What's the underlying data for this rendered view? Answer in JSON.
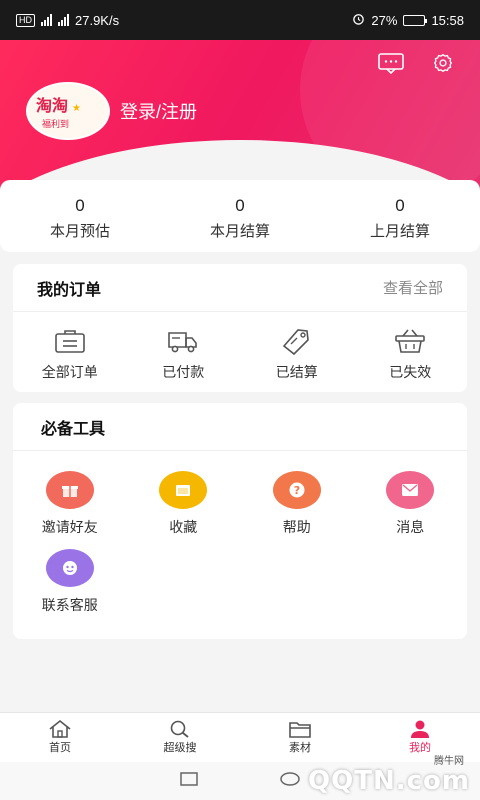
{
  "status_bar": {
    "network_badge": "HD",
    "net_speed": "27.9K/s",
    "battery": "27%",
    "battery_level": 0.27,
    "time": "15:58"
  },
  "header": {
    "login_label": "登录/注册",
    "avatar_logo_text": "淘淘福利到",
    "message_icon": "message-icon",
    "settings_icon": "gear-icon",
    "gradient_start": "#ff2a5c",
    "gradient_end": "#e8306e"
  },
  "stats": [
    {
      "value": "0",
      "label": "本月预估"
    },
    {
      "value": "0",
      "label": "本月结算"
    },
    {
      "value": "0",
      "label": "上月结算"
    }
  ],
  "orders": {
    "title": "我的订单",
    "more": "查看全部",
    "items": [
      {
        "label": "全部订单",
        "icon": "all-orders-icon"
      },
      {
        "label": "已付款",
        "icon": "truck-icon"
      },
      {
        "label": "已结算",
        "icon": "tag-icon"
      },
      {
        "label": "已失效",
        "icon": "basket-icon"
      }
    ]
  },
  "tools": {
    "title": "必备工具",
    "items": [
      {
        "label": "邀请好友",
        "icon": "gift-icon",
        "color": "#f26a5b"
      },
      {
        "label": "收藏",
        "icon": "folder-icon",
        "color": "#f5b700"
      },
      {
        "label": "帮助",
        "icon": "help-icon",
        "color": "#f2774a"
      },
      {
        "label": "消息",
        "icon": "mail-icon",
        "color": "#f0668c"
      },
      {
        "label": "联系客服",
        "icon": "service-icon",
        "color": "#9a74e6"
      }
    ]
  },
  "tabbar": {
    "items": [
      {
        "label": "首页",
        "icon": "home-icon"
      },
      {
        "label": "超级搜",
        "icon": "search-icon"
      },
      {
        "label": "素材",
        "icon": "folder-icon"
      },
      {
        "label": "我的",
        "icon": "user-icon",
        "active": true
      }
    ],
    "active_color": "#e8245d"
  },
  "watermark": {
    "main": "QQTN.com",
    "sub": "腾牛网"
  }
}
